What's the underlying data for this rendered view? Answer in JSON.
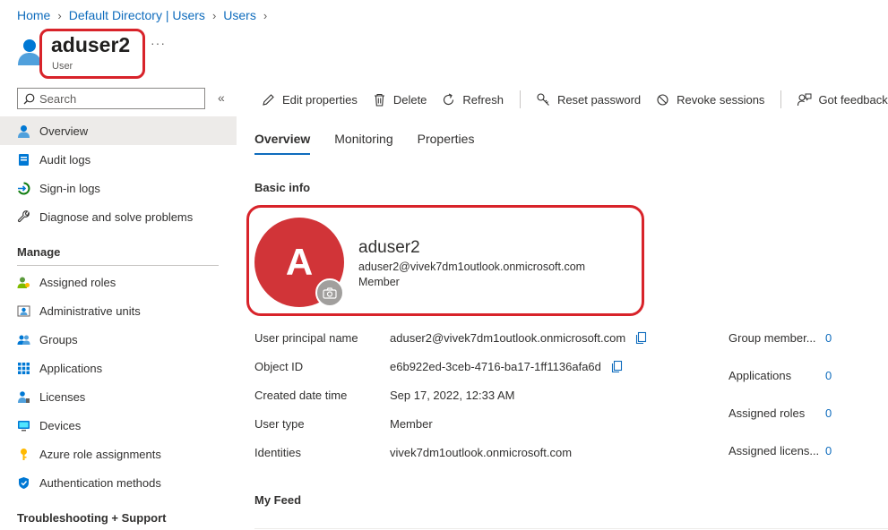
{
  "breadcrumb": {
    "items": [
      "Home",
      "Default Directory | Users",
      "Users"
    ]
  },
  "header": {
    "title": "aduser2",
    "subtitle": "User",
    "more": "···"
  },
  "search": {
    "placeholder": "Search",
    "collapse": "«"
  },
  "sidebar": {
    "items": [
      {
        "label": "Overview",
        "icon": "user-icon"
      },
      {
        "label": "Audit logs",
        "icon": "audit-log-icon"
      },
      {
        "label": "Sign-in logs",
        "icon": "sign-in-icon"
      },
      {
        "label": "Diagnose and solve problems",
        "icon": "wrench-icon"
      }
    ],
    "manage_heading": "Manage",
    "manage_items": [
      {
        "label": "Assigned roles",
        "icon": "roles-icon"
      },
      {
        "label": "Administrative units",
        "icon": "admin-units-icon"
      },
      {
        "label": "Groups",
        "icon": "groups-icon"
      },
      {
        "label": "Applications",
        "icon": "applications-icon"
      },
      {
        "label": "Licenses",
        "icon": "licenses-icon"
      },
      {
        "label": "Devices",
        "icon": "devices-icon"
      },
      {
        "label": "Azure role assignments",
        "icon": "key-icon"
      },
      {
        "label": "Authentication methods",
        "icon": "shield-icon"
      }
    ],
    "troubleshoot_heading": "Troubleshooting + Support"
  },
  "toolbar": {
    "edit": "Edit properties",
    "delete": "Delete",
    "refresh": "Refresh",
    "reset_password": "Reset password",
    "revoke_sessions": "Revoke sessions",
    "feedback": "Got feedback?"
  },
  "tabs": [
    "Overview",
    "Monitoring",
    "Properties"
  ],
  "basic_info": {
    "heading": "Basic info",
    "avatar_letter": "A",
    "name": "aduser2",
    "email": "aduser2@vivek7dm1outlook.onmicrosoft.com",
    "user_type": "Member"
  },
  "properties": [
    {
      "label": "User principal name",
      "value": "aduser2@vivek7dm1outlook.onmicrosoft.com"
    },
    {
      "label": "Object ID",
      "value": "e6b922ed-3ceb-4716-ba17-1ff1136afa6d"
    },
    {
      "label": "Created date time",
      "value": "Sep 17, 2022, 12:33 AM"
    },
    {
      "label": "User type",
      "value": "Member"
    },
    {
      "label": "Identities",
      "value": "vivek7dm1outlook.onmicrosoft.com"
    }
  ],
  "stats": [
    {
      "label": "Group member...",
      "value": "0"
    },
    {
      "label": "Applications",
      "value": "0"
    },
    {
      "label": "Assigned roles",
      "value": "0"
    },
    {
      "label": "Assigned licens...",
      "value": "0"
    }
  ],
  "my_feed": "My Feed",
  "colors": {
    "accent": "#0f6cbd",
    "avatar": "#d13438",
    "highlight": "#d8232a"
  }
}
